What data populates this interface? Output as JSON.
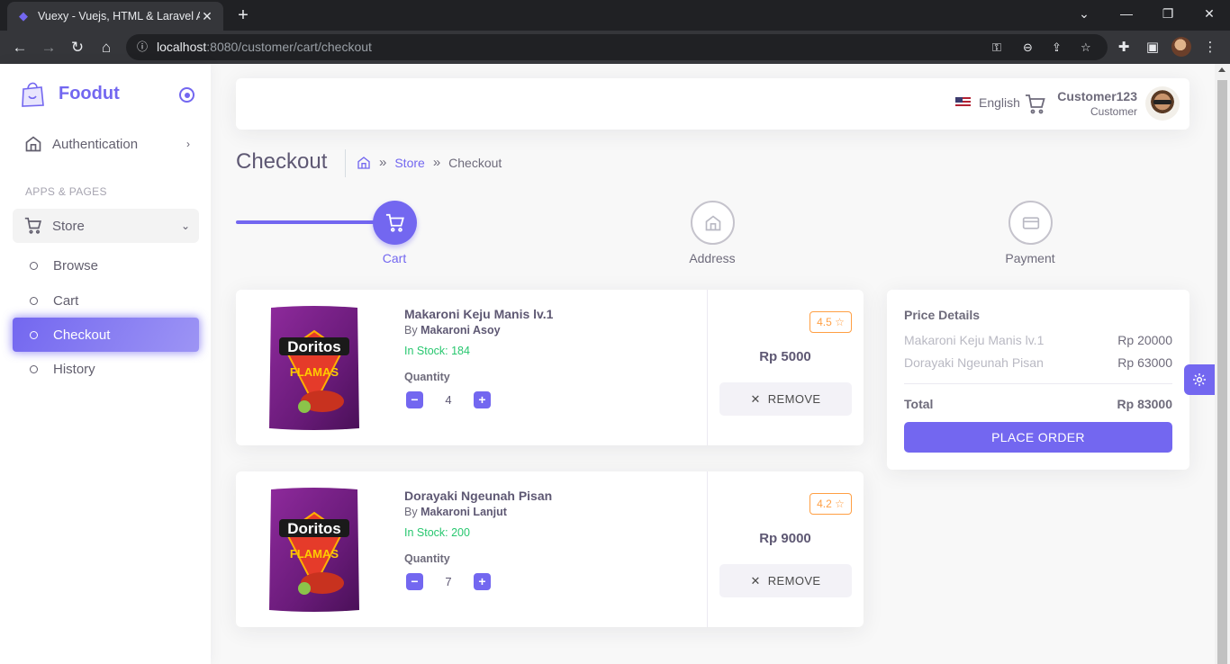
{
  "browser": {
    "tab_title": "Vuexy - Vuejs, HTML & Laravel A",
    "url_host": "localhost",
    "url_rest": ":8080/customer/cart/checkout"
  },
  "sidebar": {
    "brand": "Foodut",
    "items": [
      {
        "label": "Authentication",
        "icon": "home-icon"
      }
    ],
    "section": "APPS & PAGES",
    "store": {
      "label": "Store",
      "icon": "shopping-cart-icon"
    },
    "sub_items": [
      {
        "label": "Browse"
      },
      {
        "label": "Cart"
      },
      {
        "label": "Checkout",
        "active": true
      },
      {
        "label": "History"
      }
    ]
  },
  "navbar": {
    "language": "English",
    "user_name": "Customer123",
    "user_role": "Customer"
  },
  "page": {
    "title": "Checkout",
    "breadcrumb": [
      "Store",
      "Checkout"
    ]
  },
  "steps": [
    {
      "label": "Cart",
      "icon": "shopping-cart-icon",
      "active": true
    },
    {
      "label": "Address",
      "icon": "home-icon",
      "active": false
    },
    {
      "label": "Payment",
      "icon": "credit-card-icon",
      "active": false
    }
  ],
  "products": [
    {
      "name": "Makaroni Keju Manis lv.1",
      "by_prefix": "By",
      "seller": "Makaroni Asoy",
      "stock": "In Stock: 184",
      "quantity_label": "Quantity",
      "quantity": "4",
      "rating": "4.5",
      "price": "Rp 5000",
      "remove_label": "REMOVE"
    },
    {
      "name": "Dorayaki Ngeunah Pisan",
      "by_prefix": "By",
      "seller": "Makaroni Lanjut",
      "stock": "In Stock: 200",
      "quantity_label": "Quantity",
      "quantity": "7",
      "rating": "4.2",
      "price": "Rp 9000",
      "remove_label": "REMOVE"
    }
  ],
  "summary": {
    "title": "Price Details",
    "rows": [
      {
        "label": "Makaroni Keju Manis lv.1",
        "amount": "Rp 20000"
      },
      {
        "label": "Dorayaki Ngeunah Pisan",
        "amount": "Rp 63000"
      }
    ],
    "total_label": "Total",
    "total_amount": "Rp 83000",
    "button": "PLACE ORDER"
  },
  "colors": {
    "primary": "#7367f0",
    "success": "#28c76f",
    "warning": "#ff9f43"
  }
}
